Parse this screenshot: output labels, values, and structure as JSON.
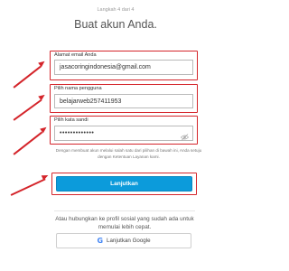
{
  "header": {
    "step": "Langkah 4 dari 4",
    "title": "Buat akun Anda."
  },
  "form": {
    "email": {
      "label": "Alamat email Anda",
      "value": "jasacoringindonesia@gmail.com"
    },
    "username": {
      "label": "Pilih nama pengguna",
      "value": "belajarweb257411953"
    },
    "password": {
      "label": "Pilih kata sandi",
      "value": "•••••••••••••"
    },
    "terms": "Dengan membuat akun melalui salah satu dari pilihan di bawah ini, Anda setuju dengan Ketentuan Layanan kami.",
    "submit_label": "Lanjutkan"
  },
  "social": {
    "text": "Atau hubungkan ke profil sosial yang sudah ada untuk memulai lebih cepat.",
    "google_label": "Lanjutkan Google",
    "google_icon": "G"
  },
  "colors": {
    "annotation_red": "#d4242a",
    "button_blue": "#0c9bdb"
  }
}
